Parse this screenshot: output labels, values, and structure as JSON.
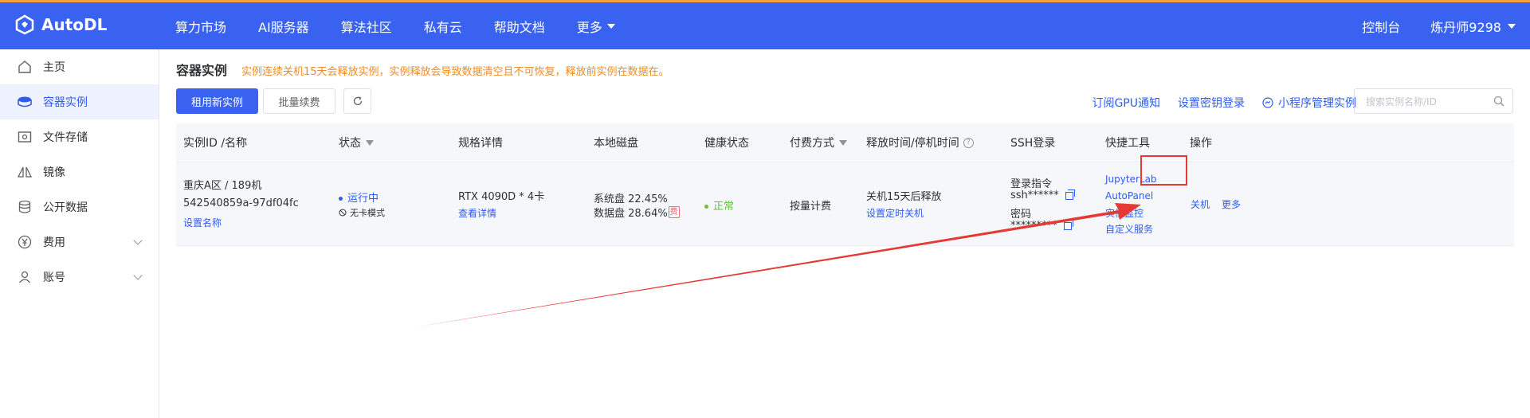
{
  "brand": {
    "name": "AutoDL",
    "colors": {
      "primary": "#3a62f0",
      "accent_line": "#f5a340",
      "warning": "#f08c24",
      "success": "#67c23a",
      "annotation": "#e53935"
    }
  },
  "nav": {
    "items": [
      "算力市场",
      "AI服务器",
      "算法社区",
      "私有云",
      "帮助文档",
      "更多"
    ],
    "console": "控制台",
    "user": "炼丹师9298"
  },
  "sidebar": {
    "items": [
      {
        "label": "主页",
        "icon": "home-icon"
      },
      {
        "label": "容器实例",
        "icon": "cube-icon",
        "active": true
      },
      {
        "label": "文件存储",
        "icon": "storage-icon"
      },
      {
        "label": "镜像",
        "icon": "mirror-icon"
      },
      {
        "label": "公开数据",
        "icon": "database-icon"
      },
      {
        "label": "费用",
        "icon": "yen-icon",
        "expandable": true
      },
      {
        "label": "账号",
        "icon": "user-icon",
        "expandable": true
      }
    ]
  },
  "page": {
    "title": "容器实例",
    "notice": "实例连续关机15天会释放实例，实例释放会导致数据清空且不可恢复，释放前实例在数据在。",
    "buttons": {
      "new_instance": "租用新实例",
      "batch_renew": "批量续费"
    },
    "links": {
      "gpu_notify": "订阅GPU通知",
      "key_login": "设置密钥登录",
      "mini_program": "小程序管理实例"
    },
    "search_placeholder": "搜索实例名称/ID"
  },
  "table": {
    "headers": {
      "id_name": "实例ID /名称",
      "status": "状态",
      "spec": "规格详情",
      "disk": "本地磁盘",
      "health": "健康状态",
      "billing": "付费方式",
      "release": "释放时间/停机时间",
      "ssh": "SSH登录",
      "tools": "快捷工具",
      "ops": "操作"
    },
    "row": {
      "region": "重庆A区 / 189机",
      "instance_id": "542540859a-97df04fc",
      "set_name": "设置名称",
      "status": "运行中",
      "mode": "无卡模式",
      "gpu": "RTX 4090D * 4卡",
      "view_detail": "查看详情",
      "sys_disk": "系统盘 22.45%",
      "data_disk": "数据盘 28.64%",
      "fee_badge": "费",
      "health": "正常",
      "billing": "按量计费",
      "release": "关机15天后释放",
      "set_timer": "设置定时关机",
      "login_cmd_label": "登录指令",
      "login_cmd": "ssh******",
      "password_label": "密码",
      "password": "*********",
      "tools": [
        "JupyterLab",
        "AutoPanel",
        "实例监控",
        "自定义服务"
      ],
      "shutdown": "关机",
      "more": "更多"
    }
  }
}
